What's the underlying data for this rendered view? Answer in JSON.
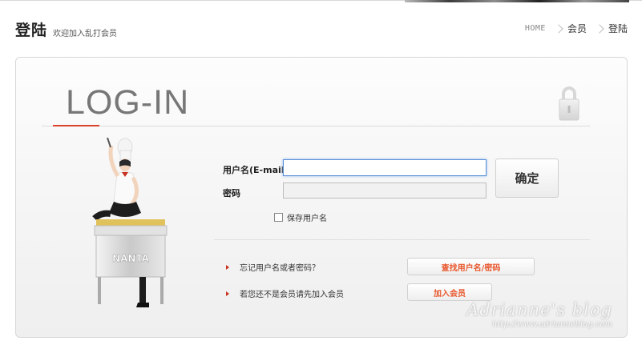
{
  "header": {
    "title": "登陆",
    "subtitle": "欢迎加入乱打会员",
    "breadcrumb": {
      "home": "HOME",
      "level1": "会员",
      "level2": "登陆"
    }
  },
  "panel": {
    "heading": "LOG-IN",
    "mascot_sign": "NANTA",
    "form": {
      "username_label": "用户名(E-mail)",
      "username_value": "",
      "password_label": "密码",
      "password_value": "",
      "confirm_label": "确定",
      "remember_label": "保存用户名",
      "remember_checked": false
    },
    "links": [
      {
        "text": "忘记用户名或者密码？",
        "button": "查找用户名/密码"
      },
      {
        "text": "若您还不是会员请先加入会员",
        "button": "加入会员"
      }
    ]
  },
  "watermark": {
    "title": "Adrianne's blog",
    "url": "http://www.adrianneblog.com"
  },
  "colors": {
    "accent": "#d9442a",
    "button_text": "#e8552a",
    "focus_border": "#5a8fd6"
  },
  "icons": {
    "lock": "lock-icon",
    "breadcrumb_separator": "chevron-right-icon",
    "link_bullet": "arrow-right-icon"
  }
}
